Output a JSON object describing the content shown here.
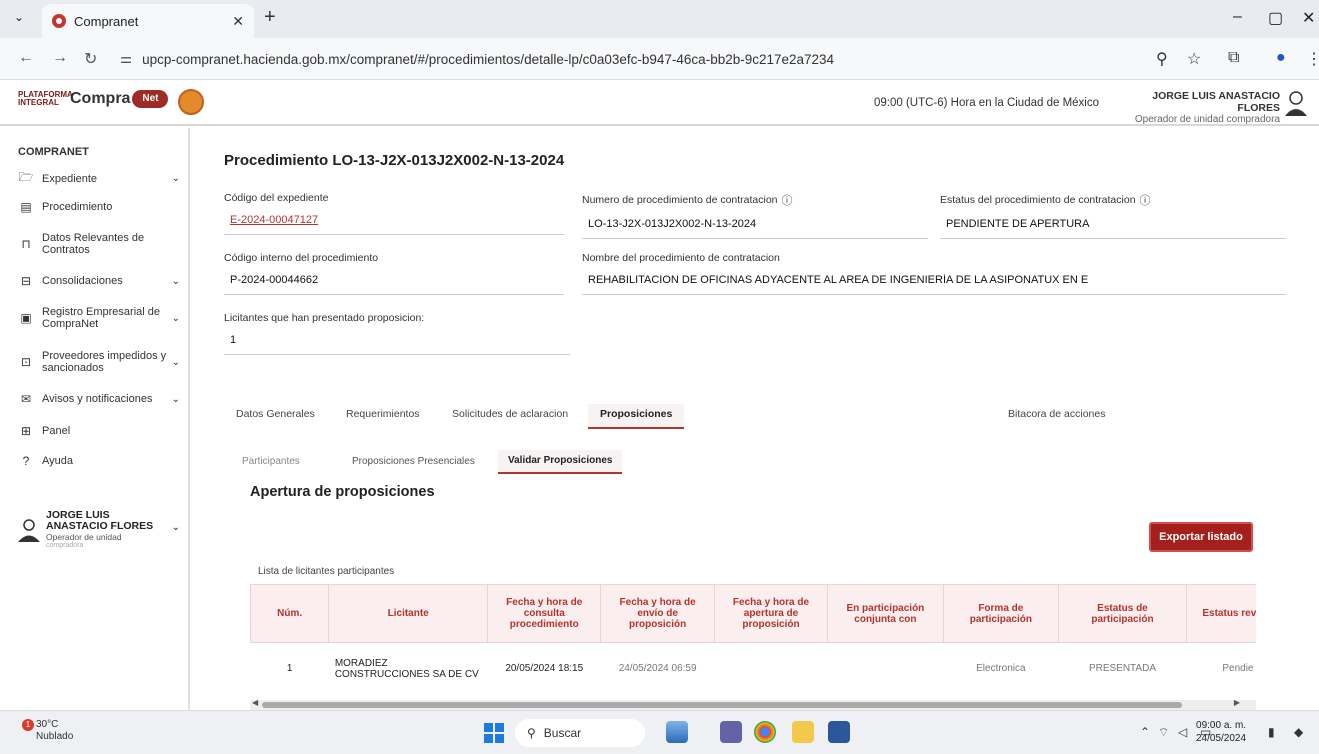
{
  "browser": {
    "tab_title": "Compranet",
    "url": "upcp-compranet.hacienda.gob.mx/compranet/#/procedimientos/detalle-lp/c0a03efc-b947-46ca-bb2b-9c217e2a7234"
  },
  "header": {
    "logo_small": "PLATAFORMA INTEGRAL",
    "logo_big": "Compra",
    "logo_bubble": "Net",
    "time_text": "09:00 (UTC-6) Hora en la Ciudad de México",
    "user_name": "JORGE LUIS ANASTACIO FLORES",
    "user_role": "Operador de unidad compradora"
  },
  "sidebar": {
    "title": "COMPRANET",
    "items": [
      {
        "label": "Expediente",
        "icon": "folder-icon",
        "chevron": "⌄"
      },
      {
        "label": "Procedimiento",
        "icon": "document-icon",
        "chevron": ""
      },
      {
        "label": "Datos Relevantes de Contratos",
        "icon": "bookmark-icon",
        "chevron": ""
      },
      {
        "label": "Consolidaciones",
        "icon": "consolidation-icon",
        "chevron": "⌄"
      },
      {
        "label": "Registro Empresarial de CompraNet",
        "icon": "id-card-icon",
        "chevron": "⌄"
      },
      {
        "label": "Proveedores impedidos y sancionados",
        "icon": "briefcase-icon",
        "chevron": "⌄"
      },
      {
        "label": "Avisos y notificaciones",
        "icon": "mail-icon",
        "chevron": "⌄"
      },
      {
        "label": "Panel",
        "icon": "grid-icon",
        "chevron": ""
      },
      {
        "label": "Ayuda",
        "icon": "help-icon",
        "chevron": ""
      }
    ],
    "user": {
      "name": "JORGE LUIS ANASTACIO FLORES",
      "role": "Operador de unidad",
      "role2": "compradora"
    }
  },
  "main": {
    "title": "Procedimiento LO-13-J2X-013J2X002-N-13-2024",
    "fields": {
      "codigo_expediente": {
        "label": "Código del expediente",
        "value": "E-2024-00047127"
      },
      "numero_procedimiento": {
        "label": "Numero de procedimiento de contratacion",
        "value": "LO-13-J2X-013J2X002-N-13-2024"
      },
      "estatus_procedimiento": {
        "label": "Estatus del procedimiento de contratacion",
        "value": "PENDIENTE DE APERTURA"
      },
      "codigo_interno": {
        "label": "Código interno del procedimiento",
        "value": "P-2024-00044662"
      },
      "nombre_procedimiento": {
        "label": "Nombre del procedimiento de contratacion",
        "value": "REHABILITACION DE OFICINAS ADYACENTE AL AREA DE INGENIERÍA DE LA ASIPONATUX EN E"
      },
      "licitantes": {
        "label": "Licitantes que han presentado proposicion:",
        "value": "1"
      }
    },
    "tabs": [
      "Datos Generales",
      "Requerimientos",
      "Solicitudes de aclaracion",
      "Proposiciones",
      "Bitacora de acciones"
    ],
    "subtabs": [
      "Participantes",
      "Proposiciones Presenciales",
      "Validar Proposiciones"
    ],
    "section_title": "Apertura de proposiciones",
    "export_label": "Exportar listado",
    "list_label": "Lista de licitantes participantes",
    "table": {
      "headers": [
        "Núm.",
        "Licitante",
        "Fecha y hora de consulta procedimiento",
        "Fecha y hora de envío de proposición",
        "Fecha y hora de apertura de proposición",
        "En participación conjunta con",
        "Forma de participación",
        "Estatus de participación",
        "Estatus revisió"
      ],
      "rows": [
        [
          "1",
          "MORADIEZ CONSTRUCCIONES SA DE CV",
          "20/05/2024 18:15",
          "24/05/2024 06:59",
          "",
          "",
          "Electronica",
          "PRESENTADA",
          "Pendie"
        ]
      ]
    }
  },
  "taskbar": {
    "temp": "30°C",
    "weather": "Nublado",
    "badge": "1",
    "search": "Buscar",
    "time": "09:00 a. m.",
    "date": "24/05/2024"
  }
}
